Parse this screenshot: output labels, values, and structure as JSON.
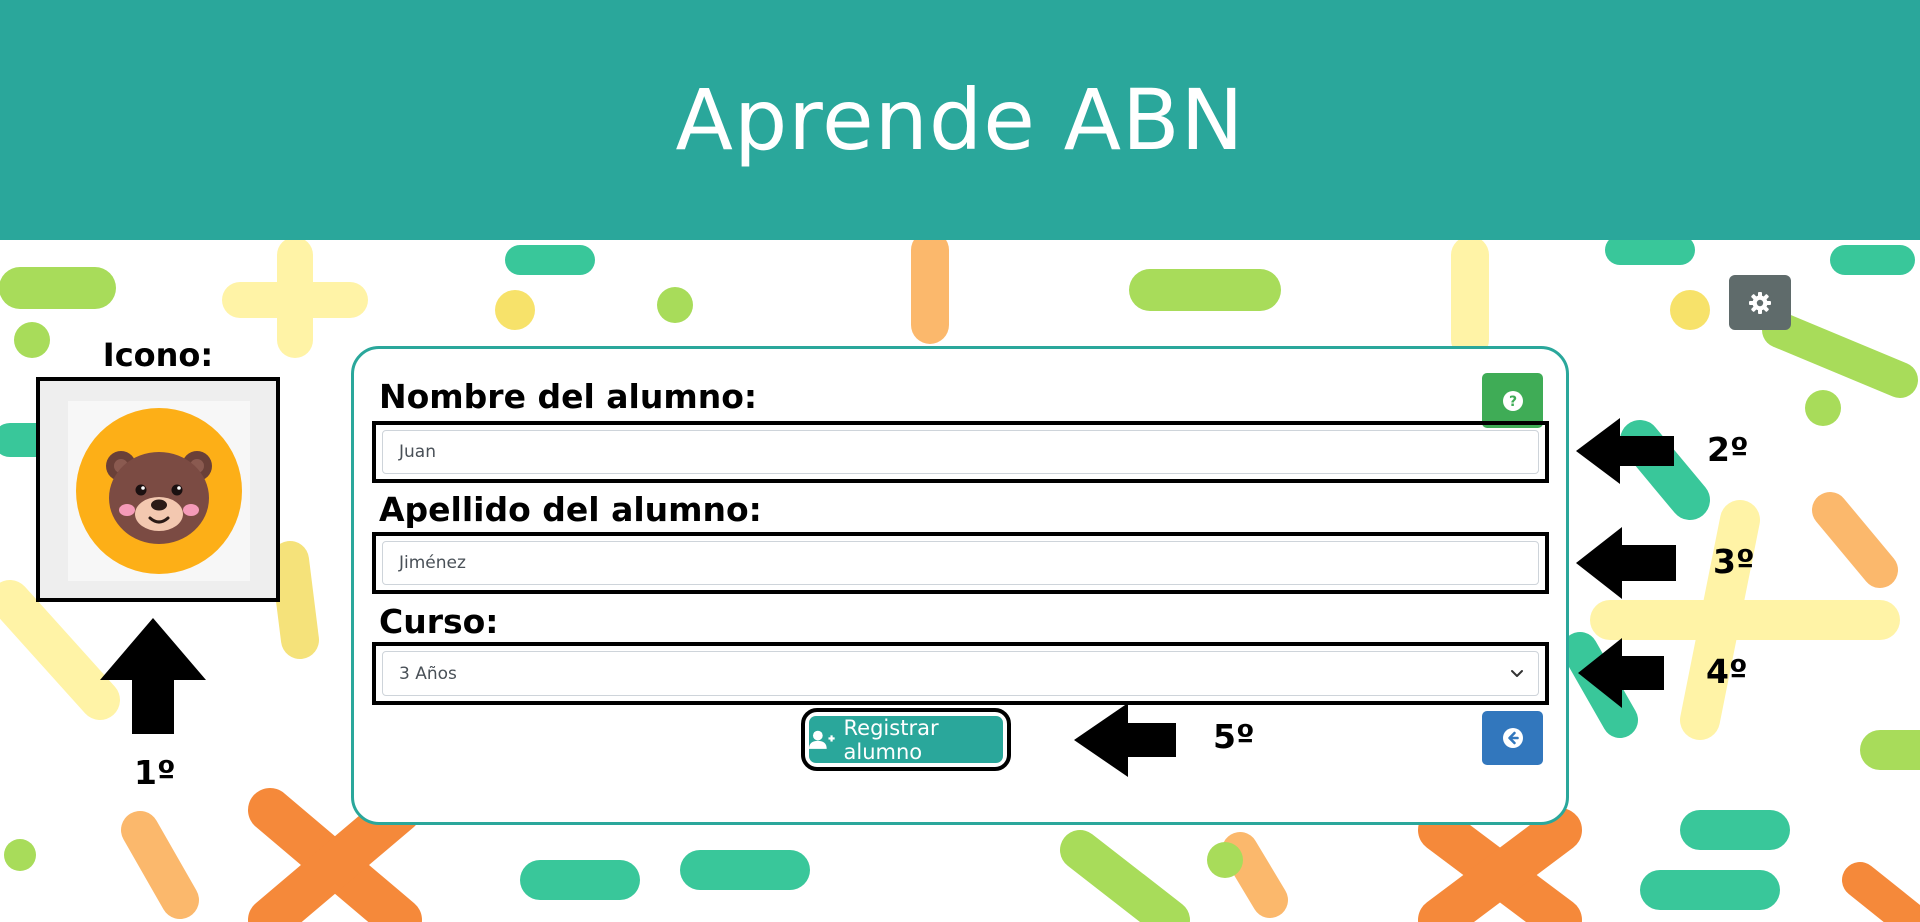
{
  "header": {
    "title": "Aprende ABN"
  },
  "icon_section": {
    "label": "Icono:",
    "selected_icon": "bear-face-icon"
  },
  "form": {
    "name_label": "Nombre del alumno:",
    "name_value": "Juan",
    "surname_label": "Apellido del alumno:",
    "surname_value": "Jiménez",
    "course_label": "Curso:",
    "course_value": "3 Años",
    "register_label": "Registrar alumno"
  },
  "annotations": {
    "step1": "1º",
    "step2": "2º",
    "step3": "3º",
    "step4": "4º",
    "step5": "5º"
  },
  "colors": {
    "header": "#2aa79b",
    "card_border": "#2aa79b",
    "register_button": "#2aa79b",
    "help_button": "#3fac56",
    "back_button": "#3277bd",
    "settings_button": "#5f6b6b"
  },
  "icons": {
    "settings": "gear-icon",
    "help": "question-circle-icon",
    "back": "arrow-circle-left-icon",
    "register": "user-plus-icon",
    "select": "chevron-down-icon"
  }
}
